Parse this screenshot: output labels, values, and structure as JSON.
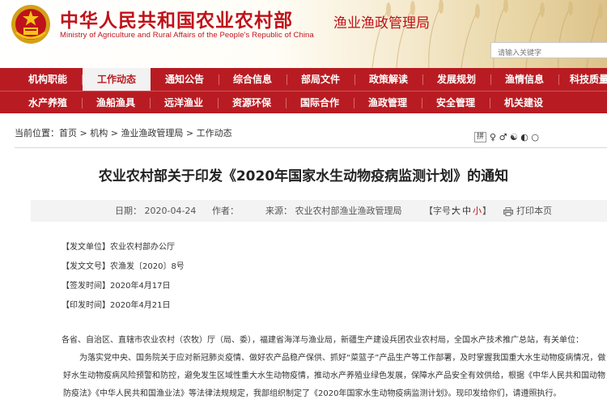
{
  "header": {
    "site_title": "中华人民共和国农业农村部",
    "site_subtitle": "Ministry of Agriculture and Rural Affairs of the People's Republic of China",
    "bureau": "渔业渔政管理局",
    "search_placeholder": "请输入关键字"
  },
  "nav": {
    "row1": [
      "机构职能",
      "工作动态",
      "通知公告",
      "综合信息",
      "部局文件",
      "政策解读",
      "发展规划",
      "渔情信息",
      "科技质量"
    ],
    "row2": [
      "水产养殖",
      "渔船渔具",
      "远洋渔业",
      "资源环保",
      "国际合作",
      "渔政管理",
      "安全管理",
      "机关建设"
    ],
    "active": "工作动态"
  },
  "breadcrumb": {
    "prefix": "当前位置：",
    "items": [
      "首页",
      "机构",
      "渔业渔政管理局",
      "工作动态"
    ],
    "sep": " > "
  },
  "tools": {
    "box": "拼",
    "symbols": "♀ ♂ ☯ ◐ ○"
  },
  "article": {
    "title": "农业农村部关于印发《2020年国家水生动物疫病监测计划》的通知",
    "date": "日期：  2020-04-24",
    "author": "作者：",
    "source": "来源：  农业农村部渔业渔政管理局",
    "size_label": "【字号：",
    "size_big": "大",
    "size_mid": "中",
    "size_small": "小",
    "size_end": "】",
    "print": "打印本页"
  },
  "info": {
    "unit": "【发文单位】农业农村部办公厅",
    "doc_no": "【发文文号】农渔发〔2020〕8号",
    "sign_date": "【签发时间】2020年4月17日",
    "print_date": "【印发时间】2020年4月21日"
  },
  "body": {
    "salutation": "各省、自治区、直辖市农业农村（农牧）厅（局、委），福建省海洋与渔业局，新疆生产建设兵团农业农村局，全国水产技术推广总站，有关单位：",
    "p1": "为落实党中央、国务院关于应对新冠肺炎疫情、做好农产品稳产保供、抓好“菜篮子”产品生产等工作部署，及时掌握我国重大水生动物疫病情况，做好水生动物疫病风险预警和防控，避免发生区域性重大水生动物疫情，推动水产养殖业绿色发展，保障水产品安全有效供给，根据《中华人民共和国动物防疫法》《中华人民共和国渔业法》等法律法规规定，我部组织制定了《2020年国家水生动物疫病监测计划》。现印发给你们，请遵照执行。"
  },
  "colors": {
    "brand_red": "#c0121a",
    "nav_red": "#b81c22"
  }
}
